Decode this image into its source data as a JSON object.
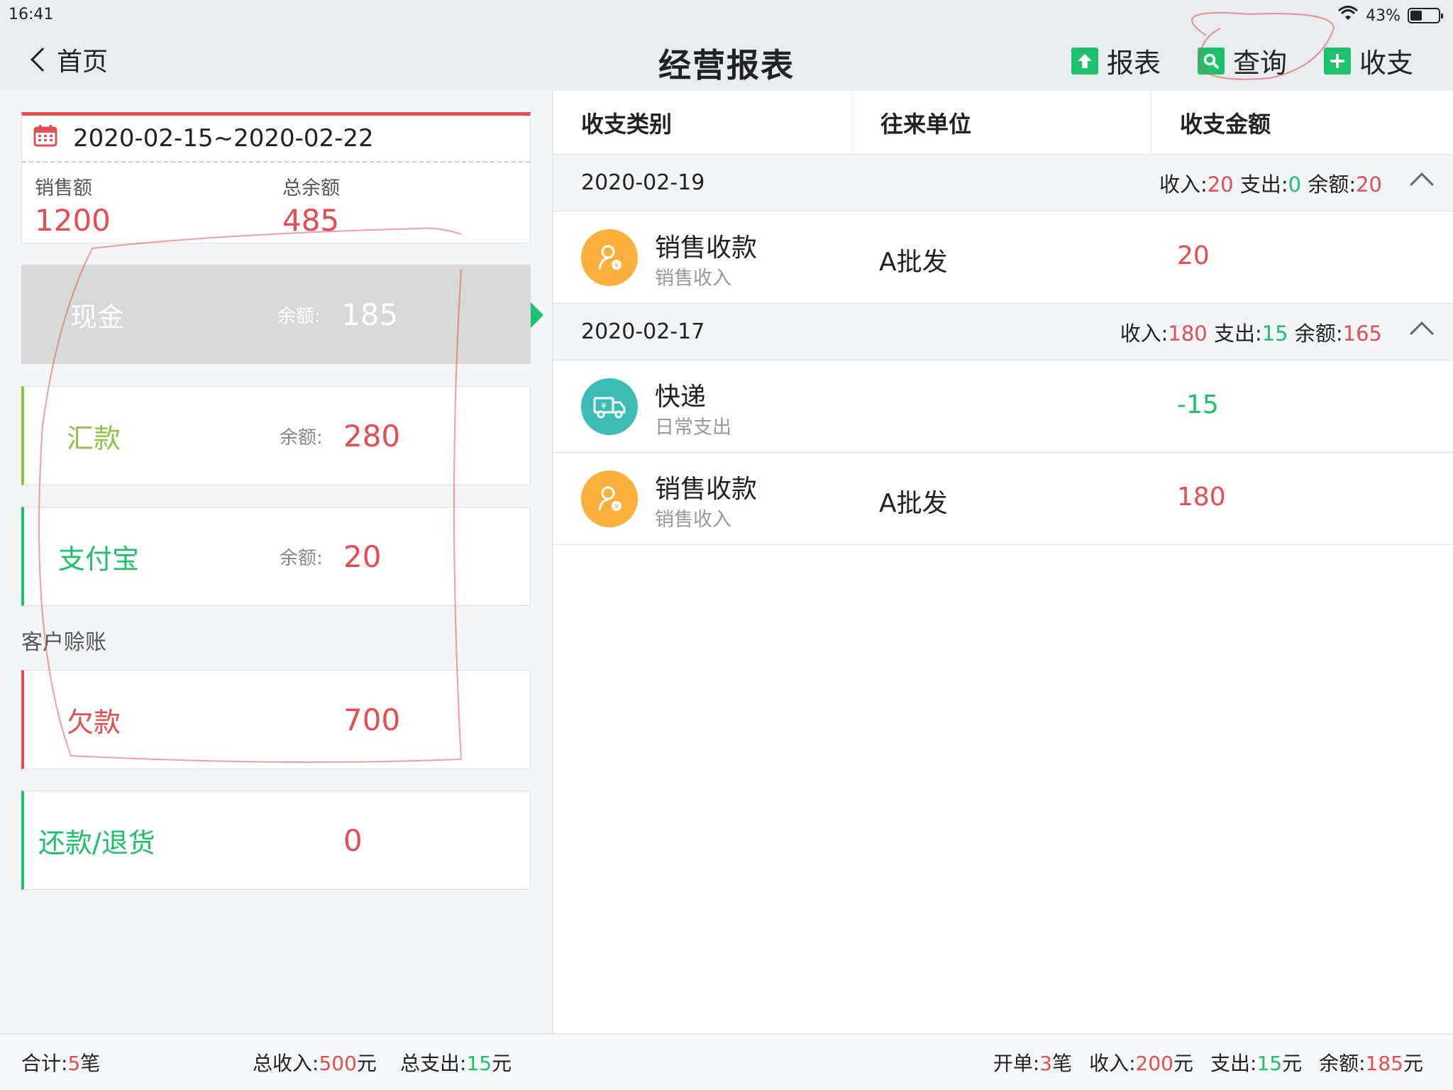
{
  "status": {
    "time": "16:41",
    "battery": "43%",
    "battery_level": 0.43
  },
  "nav": {
    "back_label": "首页",
    "title": "经营报表",
    "actions": [
      "报表",
      "查询",
      "收支"
    ]
  },
  "summary": {
    "date_range": "2020-02-15~2020-02-22",
    "sales_label": "销售额",
    "sales_value": "1200",
    "balance_label": "总余额",
    "balance_value": "485"
  },
  "accounts": [
    {
      "name": "现金",
      "bal_label": "余额:",
      "value": "185",
      "color": "#ffffff"
    },
    {
      "name": "汇款",
      "bal_label": "余额:",
      "value": "280",
      "color": "#8cc63f"
    },
    {
      "name": "支付宝",
      "bal_label": "余额:",
      "value": "20",
      "color": "#1ec16b"
    }
  ],
  "customer_section": "客户赊账",
  "credit": [
    {
      "name": "欠款",
      "value": "700",
      "name_color": "#e84c4f",
      "bar_color": "#e84c4f",
      "value_color": "#e84c4f"
    },
    {
      "name": "还款/退货",
      "value": "0",
      "name_color": "#1ec16b",
      "bar_color": "#1ec16b",
      "value_color": "#e84c4f"
    }
  ],
  "left_footer": {
    "count_label": "合计:",
    "count": "5",
    "count_unit": "笔",
    "income_label": "总收入:",
    "income": "500",
    "income_unit": "元",
    "expense_label": "总支出:",
    "expense": "15",
    "expense_unit": "元"
  },
  "table": {
    "headers": [
      "收支类别",
      "往来单位",
      "收支金额"
    ],
    "groups": [
      {
        "date": "2020-02-19",
        "in_label": "收入:",
        "in": "20",
        "out_label": "支出:",
        "out": "0",
        "bal_label": "余额:",
        "bal": "20",
        "rows": [
          {
            "category": "销售收款",
            "sub": "销售收入",
            "party": "A批发",
            "amount": "20",
            "icon": "sales-icon",
            "icon_color": "#fbb03b",
            "amount_color": "#e84c4f"
          }
        ]
      },
      {
        "date": "2020-02-17",
        "in_label": "收入:",
        "in": "180",
        "out_label": "支出:",
        "out": "15",
        "bal_label": "余额:",
        "bal": "165",
        "rows": [
          {
            "category": "快递",
            "sub": "日常支出",
            "party": "",
            "amount": "-15",
            "icon": "delivery-truck-icon",
            "icon_color": "#3dbcb6",
            "amount_color": "#1ec16b"
          },
          {
            "category": "销售收款",
            "sub": "销售收入",
            "party": "A批发",
            "amount": "180",
            "icon": "sales-icon",
            "icon_color": "#fbb03b",
            "amount_color": "#e84c4f"
          }
        ]
      }
    ]
  },
  "right_footer": {
    "orders_label": "开单:",
    "orders": "3",
    "orders_unit": "笔",
    "income_label": "收入:",
    "income": "200",
    "income_unit": "元",
    "expense_label": "支出:",
    "expense": "15",
    "expense_unit": "元",
    "bal_label": "余额:",
    "bal": "185",
    "bal_unit": "元"
  }
}
